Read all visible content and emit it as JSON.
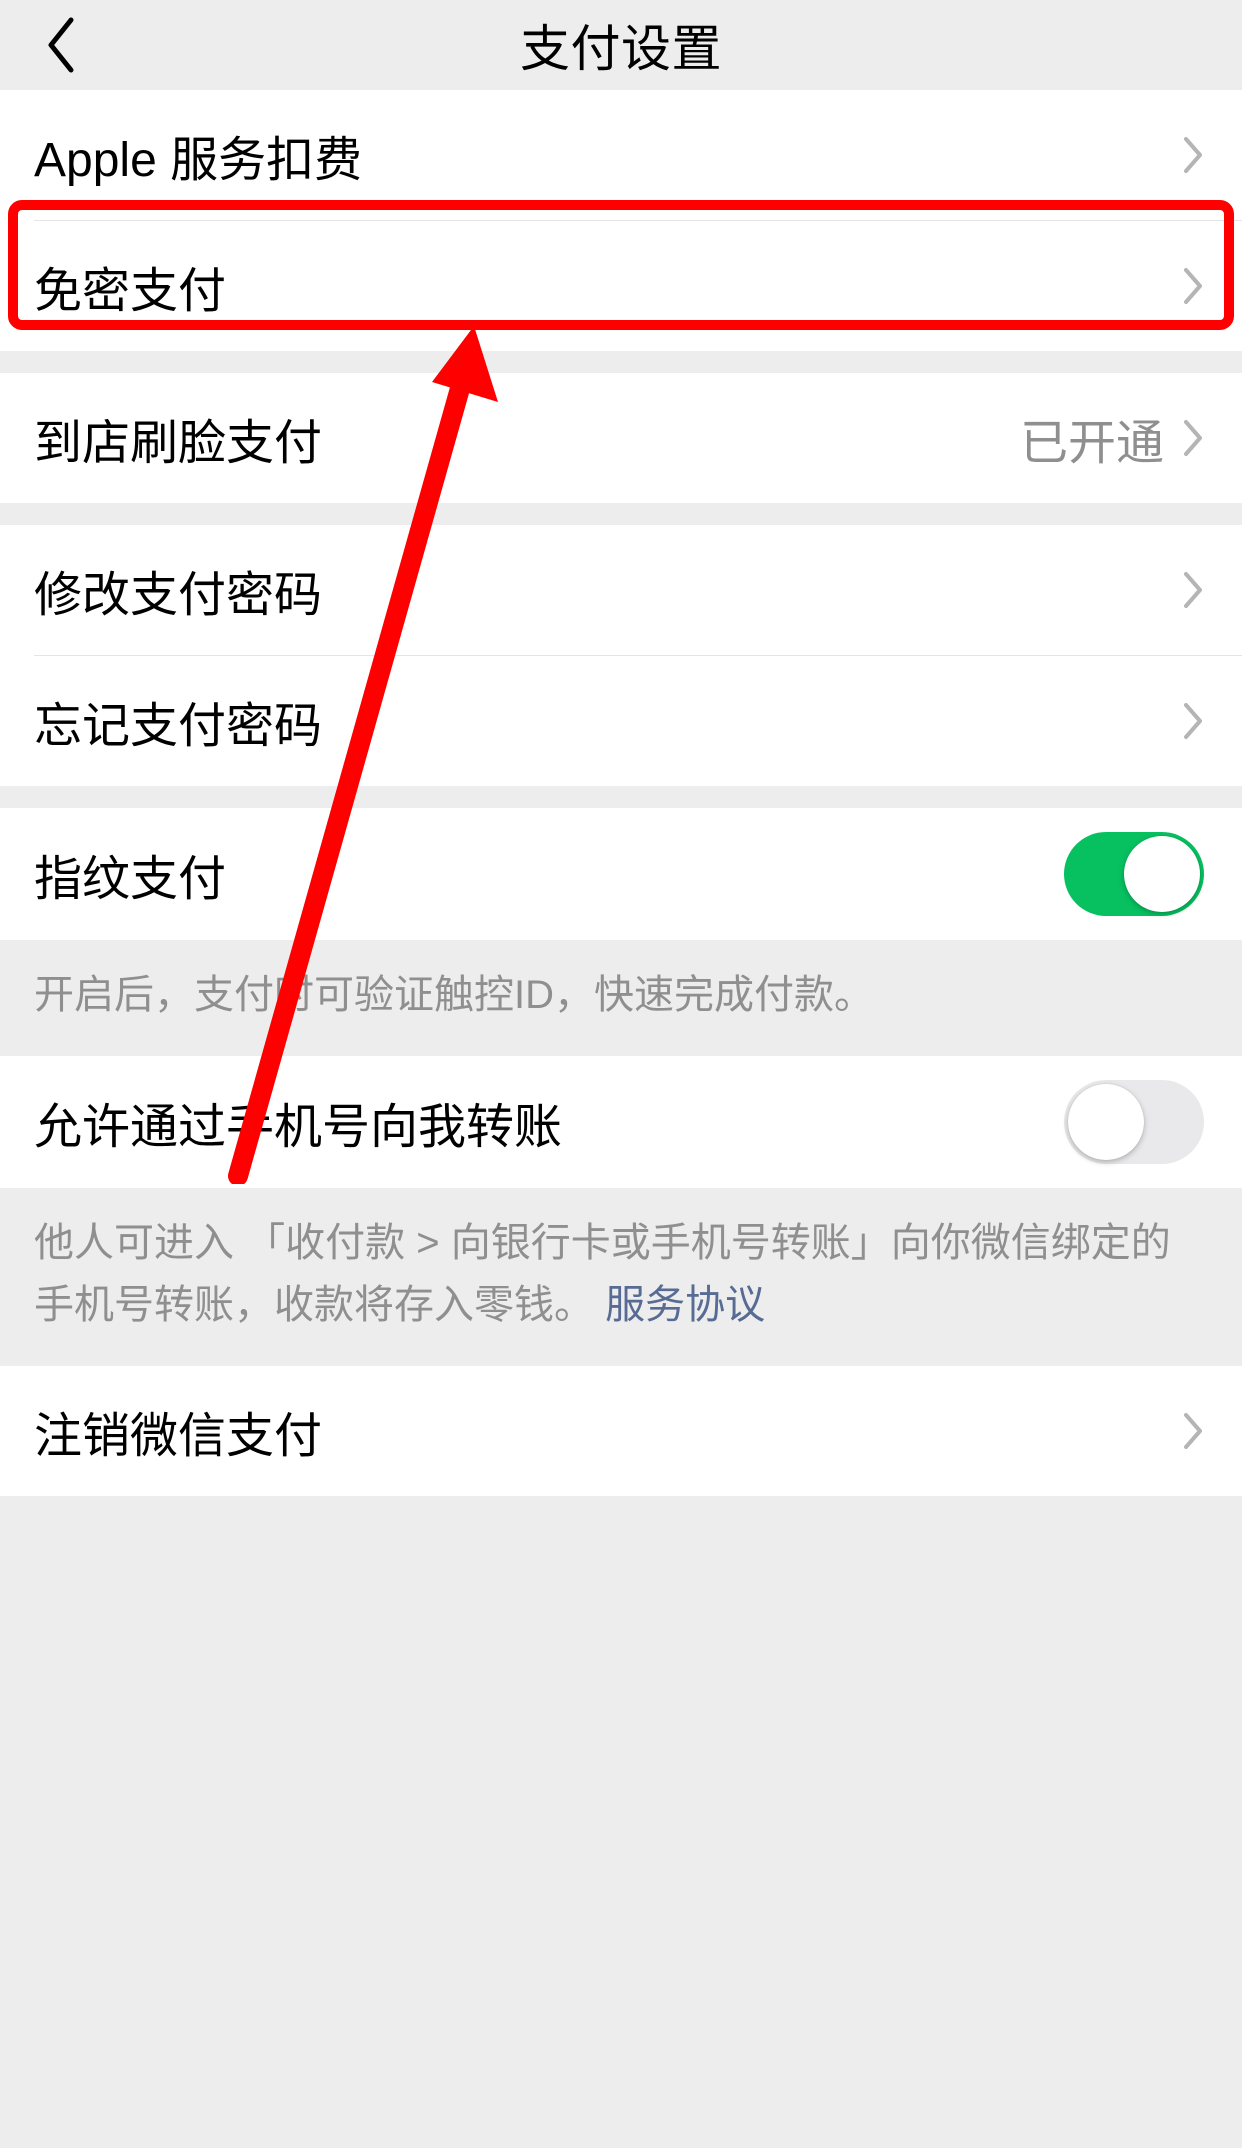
{
  "header": {
    "title": "支付设置"
  },
  "groups": [
    {
      "hint": null,
      "cells": [
        {
          "key": "apple",
          "label": "Apple 服务扣费",
          "value": "",
          "chevron": true,
          "toggle": null
        },
        {
          "key": "nopwd",
          "label": "免密支付",
          "value": "",
          "chevron": true,
          "toggle": null
        }
      ]
    },
    {
      "hint": null,
      "cells": [
        {
          "key": "facepay",
          "label": "到店刷脸支付",
          "value": "已开通",
          "chevron": true,
          "toggle": null
        }
      ]
    },
    {
      "hint": null,
      "cells": [
        {
          "key": "changepwd",
          "label": "修改支付密码",
          "value": "",
          "chevron": true,
          "toggle": null
        },
        {
          "key": "forgotpwd",
          "label": "忘记支付密码",
          "value": "",
          "chevron": true,
          "toggle": null
        }
      ]
    },
    {
      "hint": {
        "text": "开启后，支付时可验证触控ID，快速完成付款。",
        "link": null
      },
      "cells": [
        {
          "key": "fingerprint",
          "label": "指纹支付",
          "value": "",
          "chevron": false,
          "toggle": "on"
        }
      ]
    },
    {
      "hint": {
        "text": "他人可进入 「收付款 > 向银行卡或手机号转账」向你微信绑定的手机号转账，收款将存入零钱。",
        "link": "服务协议"
      },
      "cells": [
        {
          "key": "phonetransfer",
          "label": "允许通过手机号向我转账",
          "value": "",
          "chevron": false,
          "toggle": "off"
        }
      ]
    },
    {
      "hint": null,
      "cells": [
        {
          "key": "deregister",
          "label": "注销微信支付",
          "value": "",
          "chevron": true,
          "toggle": null
        }
      ]
    }
  ]
}
